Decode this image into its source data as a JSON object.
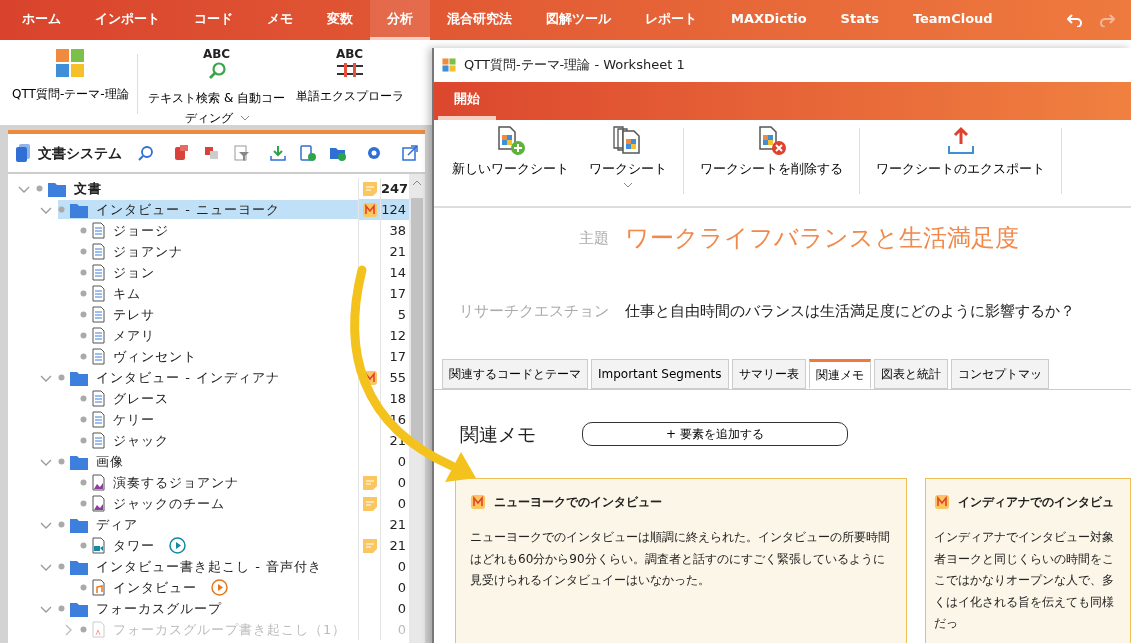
{
  "menu": {
    "items": [
      {
        "label": "ホーム",
        "selected": false
      },
      {
        "label": "インポート",
        "selected": false
      },
      {
        "label": "コード",
        "selected": false
      },
      {
        "label": "メモ",
        "selected": false
      },
      {
        "label": "変数",
        "selected": false
      },
      {
        "label": "分析",
        "selected": true
      },
      {
        "label": "混合研究法",
        "selected": false
      },
      {
        "label": "図解ツール",
        "selected": false
      },
      {
        "label": "レポート",
        "selected": false
      },
      {
        "label": "MAXDictio",
        "selected": false
      },
      {
        "label": "Stats",
        "selected": false
      },
      {
        "label": "TeamCloud",
        "selected": false
      }
    ]
  },
  "ribbon": {
    "buttons": [
      {
        "kind": "puzzle",
        "label": "QTT質問-テーマ-理論",
        "dropdown": false
      },
      {
        "kind": "search",
        "icon_text": "ABC",
        "label": "テキスト検索 & 自動コーディング",
        "dropdown": true
      },
      {
        "kind": "explorer",
        "icon_text": "ABC",
        "label": "単語エクスプローラ",
        "dropdown": false
      }
    ]
  },
  "document_system": {
    "title": "文書システム",
    "tree": [
      {
        "kind": "root",
        "label": "文書",
        "memo": {
          "kind": "note"
        },
        "count": "247",
        "selected": false,
        "expanded": true,
        "children": [
          {
            "kind": "folder",
            "label": "インタビュー - ニューヨーク",
            "memo": {
              "kind": "m"
            },
            "count": "124",
            "selected": true,
            "expanded": true,
            "children": [
              {
                "kind": "text",
                "label": "ジョージ",
                "count": "38",
                "selected": false
              },
              {
                "kind": "text",
                "label": "ジョアンナ",
                "count": "21",
                "selected": false
              },
              {
                "kind": "text",
                "label": "ジョン",
                "count": "14",
                "selected": false
              },
              {
                "kind": "text",
                "label": "キム",
                "count": "17",
                "selected": false
              },
              {
                "kind": "text",
                "label": "テレサ",
                "count": "5",
                "selected": false
              },
              {
                "kind": "text",
                "label": "メアリ",
                "count": "12",
                "selected": false
              },
              {
                "kind": "text",
                "label": "ヴィンセント",
                "count": "17",
                "selected": false
              }
            ]
          },
          {
            "kind": "folder",
            "label": "インタビュー - インディアナ",
            "memo": {
              "kind": "m"
            },
            "count": "55",
            "selected": false,
            "expanded": true,
            "children": [
              {
                "kind": "text",
                "label": "グレース",
                "count": "18",
                "selected": false
              },
              {
                "kind": "text",
                "label": "ケリー",
                "count": "16",
                "selected": false
              },
              {
                "kind": "text",
                "label": "ジャック",
                "count": "21",
                "selected": false
              }
            ]
          },
          {
            "kind": "folder",
            "label": "画像",
            "count": "0",
            "selected": false,
            "expanded": true,
            "children": [
              {
                "kind": "image",
                "label": "演奏するジョアンナ",
                "memo": {
                  "kind": "note"
                },
                "count": "0",
                "selected": false
              },
              {
                "kind": "image",
                "label": "ジャックのチーム",
                "memo": {
                  "kind": "note"
                },
                "count": "0",
                "selected": false
              }
            ]
          },
          {
            "kind": "folder",
            "label": "ディア",
            "count": "21",
            "selected": false,
            "expanded": true,
            "children": [
              {
                "kind": "video",
                "label": "タワー",
                "memo": {
                  "kind": "note"
                },
                "count": "21",
                "selected": false
              }
            ]
          },
          {
            "kind": "folder",
            "label": "インタビュー書き起こし - 音声付き",
            "count": "0",
            "selected": false,
            "expanded": true,
            "children": [
              {
                "kind": "audio",
                "label": "インタビュー",
                "count": "0",
                "selected": false
              }
            ]
          },
          {
            "kind": "folder",
            "label": "フォーカスグループ",
            "count": "0",
            "selected": false,
            "expanded": true,
            "children": [
              {
                "kind": "focus",
                "label": "フォーカスグループ書き起こし（1）",
                "count": "0",
                "selected": false,
                "expanded": false
              }
            ]
          }
        ]
      }
    ]
  },
  "worksheet": {
    "title": "QTT質問-テーマ-理論 - Worksheet 1",
    "tabs": [
      {
        "label": "開始",
        "selected": true
      }
    ],
    "buttons": [
      {
        "kind": "new",
        "label": "新しいワークシート",
        "dropdown": false
      },
      {
        "kind": "sheets",
        "label": "ワークシート",
        "dropdown": true
      },
      {
        "kind": "delete",
        "label": "ワークシートを削除する",
        "dropdown": false
      },
      {
        "kind": "export",
        "label": "ワークシートのエクスポート",
        "dropdown": false
      }
    ],
    "topic_label": "主題",
    "topic": "ワークライフバランスと生活満足度",
    "question_label": "リサーチクエスチョン",
    "question": "仕事と自由時間のバランスは生活満足度にどのように影響するか？",
    "section_tabs": [
      {
        "label": "関連するコードとテーマ",
        "selected": false
      },
      {
        "label": "Important Segments",
        "selected": false
      },
      {
        "label": "サマリー表",
        "selected": false
      },
      {
        "label": "関連メモ",
        "selected": true
      },
      {
        "label": "図表と統計",
        "selected": false
      },
      {
        "label": "コンセプトマッ",
        "selected": false
      }
    ],
    "memos_heading": "関連メモ",
    "add_button": "+ 要素を追加する",
    "cards": [
      {
        "title": "ニューヨークでのインタビュー",
        "text": "ニューヨークでのインタビューは順調に終えられた。インタビューの所要時間はどれも60分から90分くらい。調査者と話すのにすごく緊張しているように見受けられるインタビュイーはいなかった。"
      },
      {
        "title": "インディアナでのインタビュ",
        "text": "インディアナでインタビュー対象者ヨークと同じくらいの時間をここではかなりオープンな人で、多くはイ化される旨を伝えても同様だっ"
      }
    ]
  }
}
